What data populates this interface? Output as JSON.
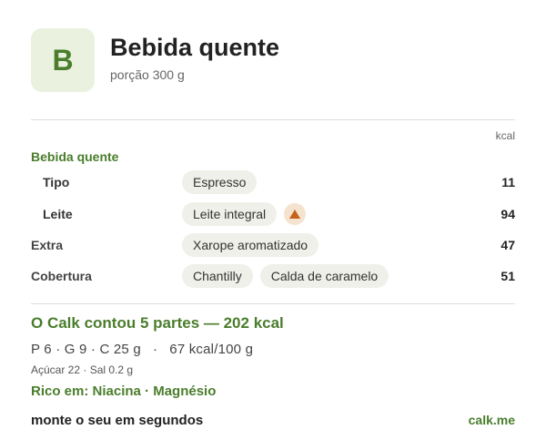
{
  "header": {
    "badge_letter": "B",
    "title": "Bebida quente",
    "subtitle": "porção 300 g"
  },
  "table": {
    "unit_label": "kcal",
    "section_label": "Bebida quente",
    "rows": [
      {
        "name": "Tipo",
        "chips": [
          "Espresso"
        ],
        "kcal": "11",
        "warning": false
      },
      {
        "name": "Leite",
        "chips": [
          "Leite integral"
        ],
        "kcal": "94",
        "warning": true
      },
      {
        "name": "Extra",
        "chips": [
          "Xarope aromatizado"
        ],
        "kcal": "47",
        "warning": false
      },
      {
        "name": "Cobertura",
        "chips": [
          "Chantilly",
          "Calda de caramelo"
        ],
        "kcal": "51",
        "warning": false
      }
    ]
  },
  "summary": {
    "headline": "O Calk contou 5 partes — 202 kcal",
    "macros": "P 6 · G 9 · C 25 g   ·   67 kcal/100 g",
    "micros": "Açúcar 22 · Sal 0.2 g",
    "rich_in": "Rico em: Niacina · Magnésio"
  },
  "footer": {
    "cta": "monte o seu em segundos",
    "link": "calk.me"
  },
  "colors": {
    "accent": "#4a7d2c",
    "badge_bg": "#eaf1df",
    "chip_bg": "#f0f0ea",
    "warning": "#c4621b"
  },
  "icons": {
    "warning": "warning-triangle-icon"
  }
}
